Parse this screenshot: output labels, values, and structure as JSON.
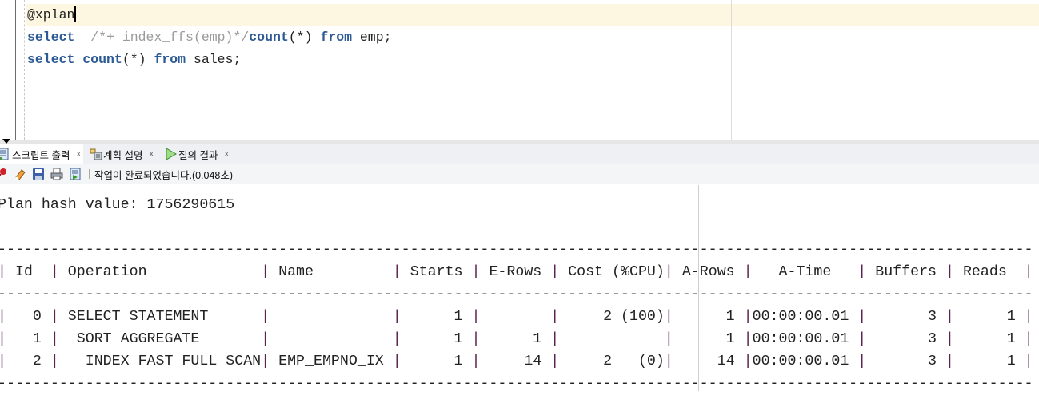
{
  "editor": {
    "lines": [
      {
        "text": "@xplan"
      },
      {
        "kw1": "select",
        "comment": "  /*+ index_ffs(emp)*/",
        "kw2": "count",
        "t1": "(*) ",
        "kw3": "from",
        "t2": " emp;"
      },
      {
        "kw1": "select",
        "t0": " ",
        "kw2": "count",
        "t1": "(*) ",
        "kw3": "from",
        "t2": " sales;"
      }
    ]
  },
  "tabs": [
    {
      "label": "스크립트 출력",
      "icon": "script-output-icon",
      "close": "x",
      "active": true
    },
    {
      "label": "계획 설명",
      "icon": "explain-plan-icon",
      "close": "x",
      "active": false
    },
    {
      "label": "질의 결과",
      "icon": "run-icon",
      "close": "x",
      "active": false
    }
  ],
  "toolbar": {
    "icons": [
      "pin-icon",
      "eraser-icon",
      "save-icon",
      "print-icon",
      "run-script-icon"
    ],
    "status": "작업이 완료되었습니다.(0.048초)"
  },
  "output": {
    "plan_hash": "Plan hash value: 1756290615",
    "header": [
      " Id  ",
      " Operation             ",
      " Name         ",
      " Starts ",
      " E-Rows ",
      " Cost (%CPU)",
      " A-Rows ",
      "   A-Time   ",
      " Buffers ",
      " Reads  "
    ],
    "rows": [
      [
        "   0 ",
        " SELECT STATEMENT      ",
        "              ",
        "      1 ",
        "        ",
        "     2 (100)",
        "      1 ",
        "00:00:00.01 ",
        "       3 ",
        "      1 "
      ],
      [
        "   1 ",
        "  SORT AGGREGATE       ",
        "              ",
        "      1 ",
        "      1 ",
        "            ",
        "      1 ",
        "00:00:00.01 ",
        "       3 ",
        "      1 "
      ],
      [
        "   2 ",
        "   INDEX FAST FULL SCAN",
        " EMP_EMPNO_IX ",
        "      1 ",
        "     14 ",
        "     2   (0)",
        "     14 ",
        "00:00:00.01 ",
        "       3 ",
        "      1 "
      ]
    ]
  }
}
